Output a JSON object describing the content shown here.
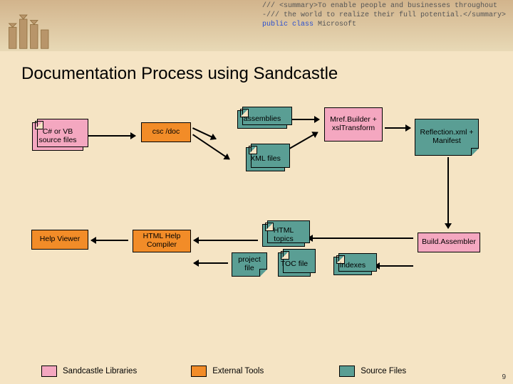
{
  "header": {
    "code_line1": "/// <summary>To enable people and businesses throughout",
    "code_line2": "-/// the world to realize their full potential.</summary>",
    "code_line3a": "public class",
    "code_line3b": "Microsoft"
  },
  "title": "Documentation Process using Sandcastle",
  "n": {
    "src": "C# or VB source files",
    "csc": "csc /doc",
    "asm": "assemblies",
    "xml": "XML files",
    "mref": "Mref.Builder + xslTransform",
    "refl": "Reflection.xml + Manifest",
    "build": "Build.Assembler",
    "topics": "HTML topics",
    "proj": "project file",
    "toc": "TOC file",
    "idx": "indexes",
    "hhc": "HTML Help Compiler",
    "hv": "Help Viewer"
  },
  "legend": {
    "sand": "Sandcastle Libraries",
    "ext": "External Tools",
    "src": "Source Files"
  },
  "page_number": "9"
}
